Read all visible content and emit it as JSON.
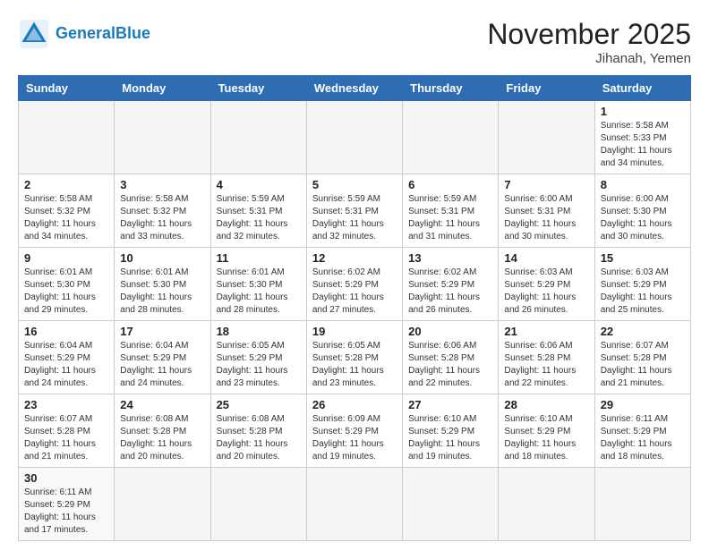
{
  "header": {
    "logo_general": "General",
    "logo_blue": "Blue",
    "month_title": "November 2025",
    "location": "Jihanah, Yemen"
  },
  "weekdays": [
    "Sunday",
    "Monday",
    "Tuesday",
    "Wednesday",
    "Thursday",
    "Friday",
    "Saturday"
  ],
  "weeks": [
    [
      {
        "day": "",
        "sunrise": "",
        "sunset": "",
        "daylight": ""
      },
      {
        "day": "",
        "sunrise": "",
        "sunset": "",
        "daylight": ""
      },
      {
        "day": "",
        "sunrise": "",
        "sunset": "",
        "daylight": ""
      },
      {
        "day": "",
        "sunrise": "",
        "sunset": "",
        "daylight": ""
      },
      {
        "day": "",
        "sunrise": "",
        "sunset": "",
        "daylight": ""
      },
      {
        "day": "",
        "sunrise": "",
        "sunset": "",
        "daylight": ""
      },
      {
        "day": "1",
        "sunrise": "Sunrise: 5:58 AM",
        "sunset": "Sunset: 5:33 PM",
        "daylight": "Daylight: 11 hours and 34 minutes."
      }
    ],
    [
      {
        "day": "2",
        "sunrise": "Sunrise: 5:58 AM",
        "sunset": "Sunset: 5:32 PM",
        "daylight": "Daylight: 11 hours and 34 minutes."
      },
      {
        "day": "3",
        "sunrise": "Sunrise: 5:58 AM",
        "sunset": "Sunset: 5:32 PM",
        "daylight": "Daylight: 11 hours and 33 minutes."
      },
      {
        "day": "4",
        "sunrise": "Sunrise: 5:59 AM",
        "sunset": "Sunset: 5:31 PM",
        "daylight": "Daylight: 11 hours and 32 minutes."
      },
      {
        "day": "5",
        "sunrise": "Sunrise: 5:59 AM",
        "sunset": "Sunset: 5:31 PM",
        "daylight": "Daylight: 11 hours and 32 minutes."
      },
      {
        "day": "6",
        "sunrise": "Sunrise: 5:59 AM",
        "sunset": "Sunset: 5:31 PM",
        "daylight": "Daylight: 11 hours and 31 minutes."
      },
      {
        "day": "7",
        "sunrise": "Sunrise: 6:00 AM",
        "sunset": "Sunset: 5:31 PM",
        "daylight": "Daylight: 11 hours and 30 minutes."
      },
      {
        "day": "8",
        "sunrise": "Sunrise: 6:00 AM",
        "sunset": "Sunset: 5:30 PM",
        "daylight": "Daylight: 11 hours and 30 minutes."
      }
    ],
    [
      {
        "day": "9",
        "sunrise": "Sunrise: 6:01 AM",
        "sunset": "Sunset: 5:30 PM",
        "daylight": "Daylight: 11 hours and 29 minutes."
      },
      {
        "day": "10",
        "sunrise": "Sunrise: 6:01 AM",
        "sunset": "Sunset: 5:30 PM",
        "daylight": "Daylight: 11 hours and 28 minutes."
      },
      {
        "day": "11",
        "sunrise": "Sunrise: 6:01 AM",
        "sunset": "Sunset: 5:30 PM",
        "daylight": "Daylight: 11 hours and 28 minutes."
      },
      {
        "day": "12",
        "sunrise": "Sunrise: 6:02 AM",
        "sunset": "Sunset: 5:29 PM",
        "daylight": "Daylight: 11 hours and 27 minutes."
      },
      {
        "day": "13",
        "sunrise": "Sunrise: 6:02 AM",
        "sunset": "Sunset: 5:29 PM",
        "daylight": "Daylight: 11 hours and 26 minutes."
      },
      {
        "day": "14",
        "sunrise": "Sunrise: 6:03 AM",
        "sunset": "Sunset: 5:29 PM",
        "daylight": "Daylight: 11 hours and 26 minutes."
      },
      {
        "day": "15",
        "sunrise": "Sunrise: 6:03 AM",
        "sunset": "Sunset: 5:29 PM",
        "daylight": "Daylight: 11 hours and 25 minutes."
      }
    ],
    [
      {
        "day": "16",
        "sunrise": "Sunrise: 6:04 AM",
        "sunset": "Sunset: 5:29 PM",
        "daylight": "Daylight: 11 hours and 24 minutes."
      },
      {
        "day": "17",
        "sunrise": "Sunrise: 6:04 AM",
        "sunset": "Sunset: 5:29 PM",
        "daylight": "Daylight: 11 hours and 24 minutes."
      },
      {
        "day": "18",
        "sunrise": "Sunrise: 6:05 AM",
        "sunset": "Sunset: 5:29 PM",
        "daylight": "Daylight: 11 hours and 23 minutes."
      },
      {
        "day": "19",
        "sunrise": "Sunrise: 6:05 AM",
        "sunset": "Sunset: 5:28 PM",
        "daylight": "Daylight: 11 hours and 23 minutes."
      },
      {
        "day": "20",
        "sunrise": "Sunrise: 6:06 AM",
        "sunset": "Sunset: 5:28 PM",
        "daylight": "Daylight: 11 hours and 22 minutes."
      },
      {
        "day": "21",
        "sunrise": "Sunrise: 6:06 AM",
        "sunset": "Sunset: 5:28 PM",
        "daylight": "Daylight: 11 hours and 22 minutes."
      },
      {
        "day": "22",
        "sunrise": "Sunrise: 6:07 AM",
        "sunset": "Sunset: 5:28 PM",
        "daylight": "Daylight: 11 hours and 21 minutes."
      }
    ],
    [
      {
        "day": "23",
        "sunrise": "Sunrise: 6:07 AM",
        "sunset": "Sunset: 5:28 PM",
        "daylight": "Daylight: 11 hours and 21 minutes."
      },
      {
        "day": "24",
        "sunrise": "Sunrise: 6:08 AM",
        "sunset": "Sunset: 5:28 PM",
        "daylight": "Daylight: 11 hours and 20 minutes."
      },
      {
        "day": "25",
        "sunrise": "Sunrise: 6:08 AM",
        "sunset": "Sunset: 5:28 PM",
        "daylight": "Daylight: 11 hours and 20 minutes."
      },
      {
        "day": "26",
        "sunrise": "Sunrise: 6:09 AM",
        "sunset": "Sunset: 5:29 PM",
        "daylight": "Daylight: 11 hours and 19 minutes."
      },
      {
        "day": "27",
        "sunrise": "Sunrise: 6:10 AM",
        "sunset": "Sunset: 5:29 PM",
        "daylight": "Daylight: 11 hours and 19 minutes."
      },
      {
        "day": "28",
        "sunrise": "Sunrise: 6:10 AM",
        "sunset": "Sunset: 5:29 PM",
        "daylight": "Daylight: 11 hours and 18 minutes."
      },
      {
        "day": "29",
        "sunrise": "Sunrise: 6:11 AM",
        "sunset": "Sunset: 5:29 PM",
        "daylight": "Daylight: 11 hours and 18 minutes."
      }
    ],
    [
      {
        "day": "30",
        "sunrise": "Sunrise: 6:11 AM",
        "sunset": "Sunset: 5:29 PM",
        "daylight": "Daylight: 11 hours and 17 minutes."
      },
      {
        "day": "",
        "sunrise": "",
        "sunset": "",
        "daylight": ""
      },
      {
        "day": "",
        "sunrise": "",
        "sunset": "",
        "daylight": ""
      },
      {
        "day": "",
        "sunrise": "",
        "sunset": "",
        "daylight": ""
      },
      {
        "day": "",
        "sunrise": "",
        "sunset": "",
        "daylight": ""
      },
      {
        "day": "",
        "sunrise": "",
        "sunset": "",
        "daylight": ""
      },
      {
        "day": "",
        "sunrise": "",
        "sunset": "",
        "daylight": ""
      }
    ]
  ]
}
